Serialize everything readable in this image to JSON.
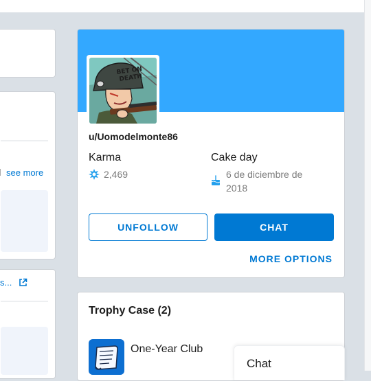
{
  "left_panel": {
    "see_more_label": "see more",
    "link_fragment": "s..."
  },
  "profile": {
    "username": "u/Uomodelmonte86",
    "karma_label": "Karma",
    "karma_value": "2,469",
    "cakeday_label": "Cake day",
    "cakeday_value_line1": "6 de diciembre de",
    "cakeday_value_line2": "2018",
    "unfollow_label": "UNFOLLOW",
    "chat_label": "CHAT",
    "more_options_label": "MORE OPTIONS",
    "avatar_text_line1": "BET ON",
    "avatar_text_line2": "DEATH"
  },
  "trophy_case": {
    "title": "Trophy Case (2)",
    "items": [
      {
        "name": "One-Year Club",
        "icon": "scroll-trophy-icon"
      }
    ]
  },
  "chat_panel": {
    "label": "Chat"
  },
  "colors": {
    "banner": "#33a8ff",
    "accent": "#0079d3",
    "background": "#dae0e6"
  }
}
